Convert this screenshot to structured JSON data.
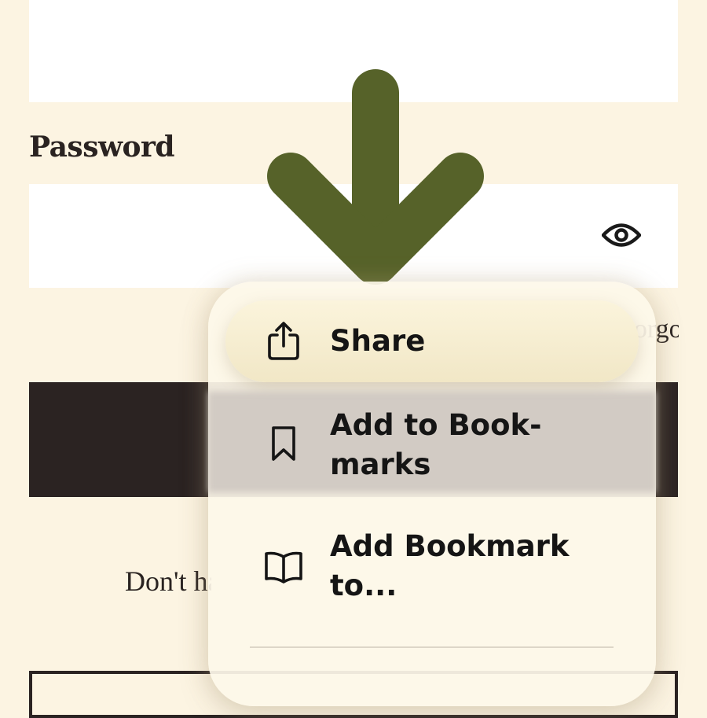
{
  "form": {
    "password_label": "Password",
    "forgot_link": "Forgot password",
    "signup_prompt": "Don't have an account?"
  },
  "context_menu": {
    "items": [
      {
        "label": "Share",
        "icon": "share-icon"
      },
      {
        "label": "Add to Book-\nmarks",
        "icon": "bookmark-icon"
      },
      {
        "label": "Add Bookmark\nto...",
        "icon": "book-icon"
      }
    ]
  },
  "colors": {
    "page_background": "#fcf4e2",
    "button_dark": "#2b2322",
    "arrow": "#566229",
    "menu_background": "#fdf8ea"
  }
}
